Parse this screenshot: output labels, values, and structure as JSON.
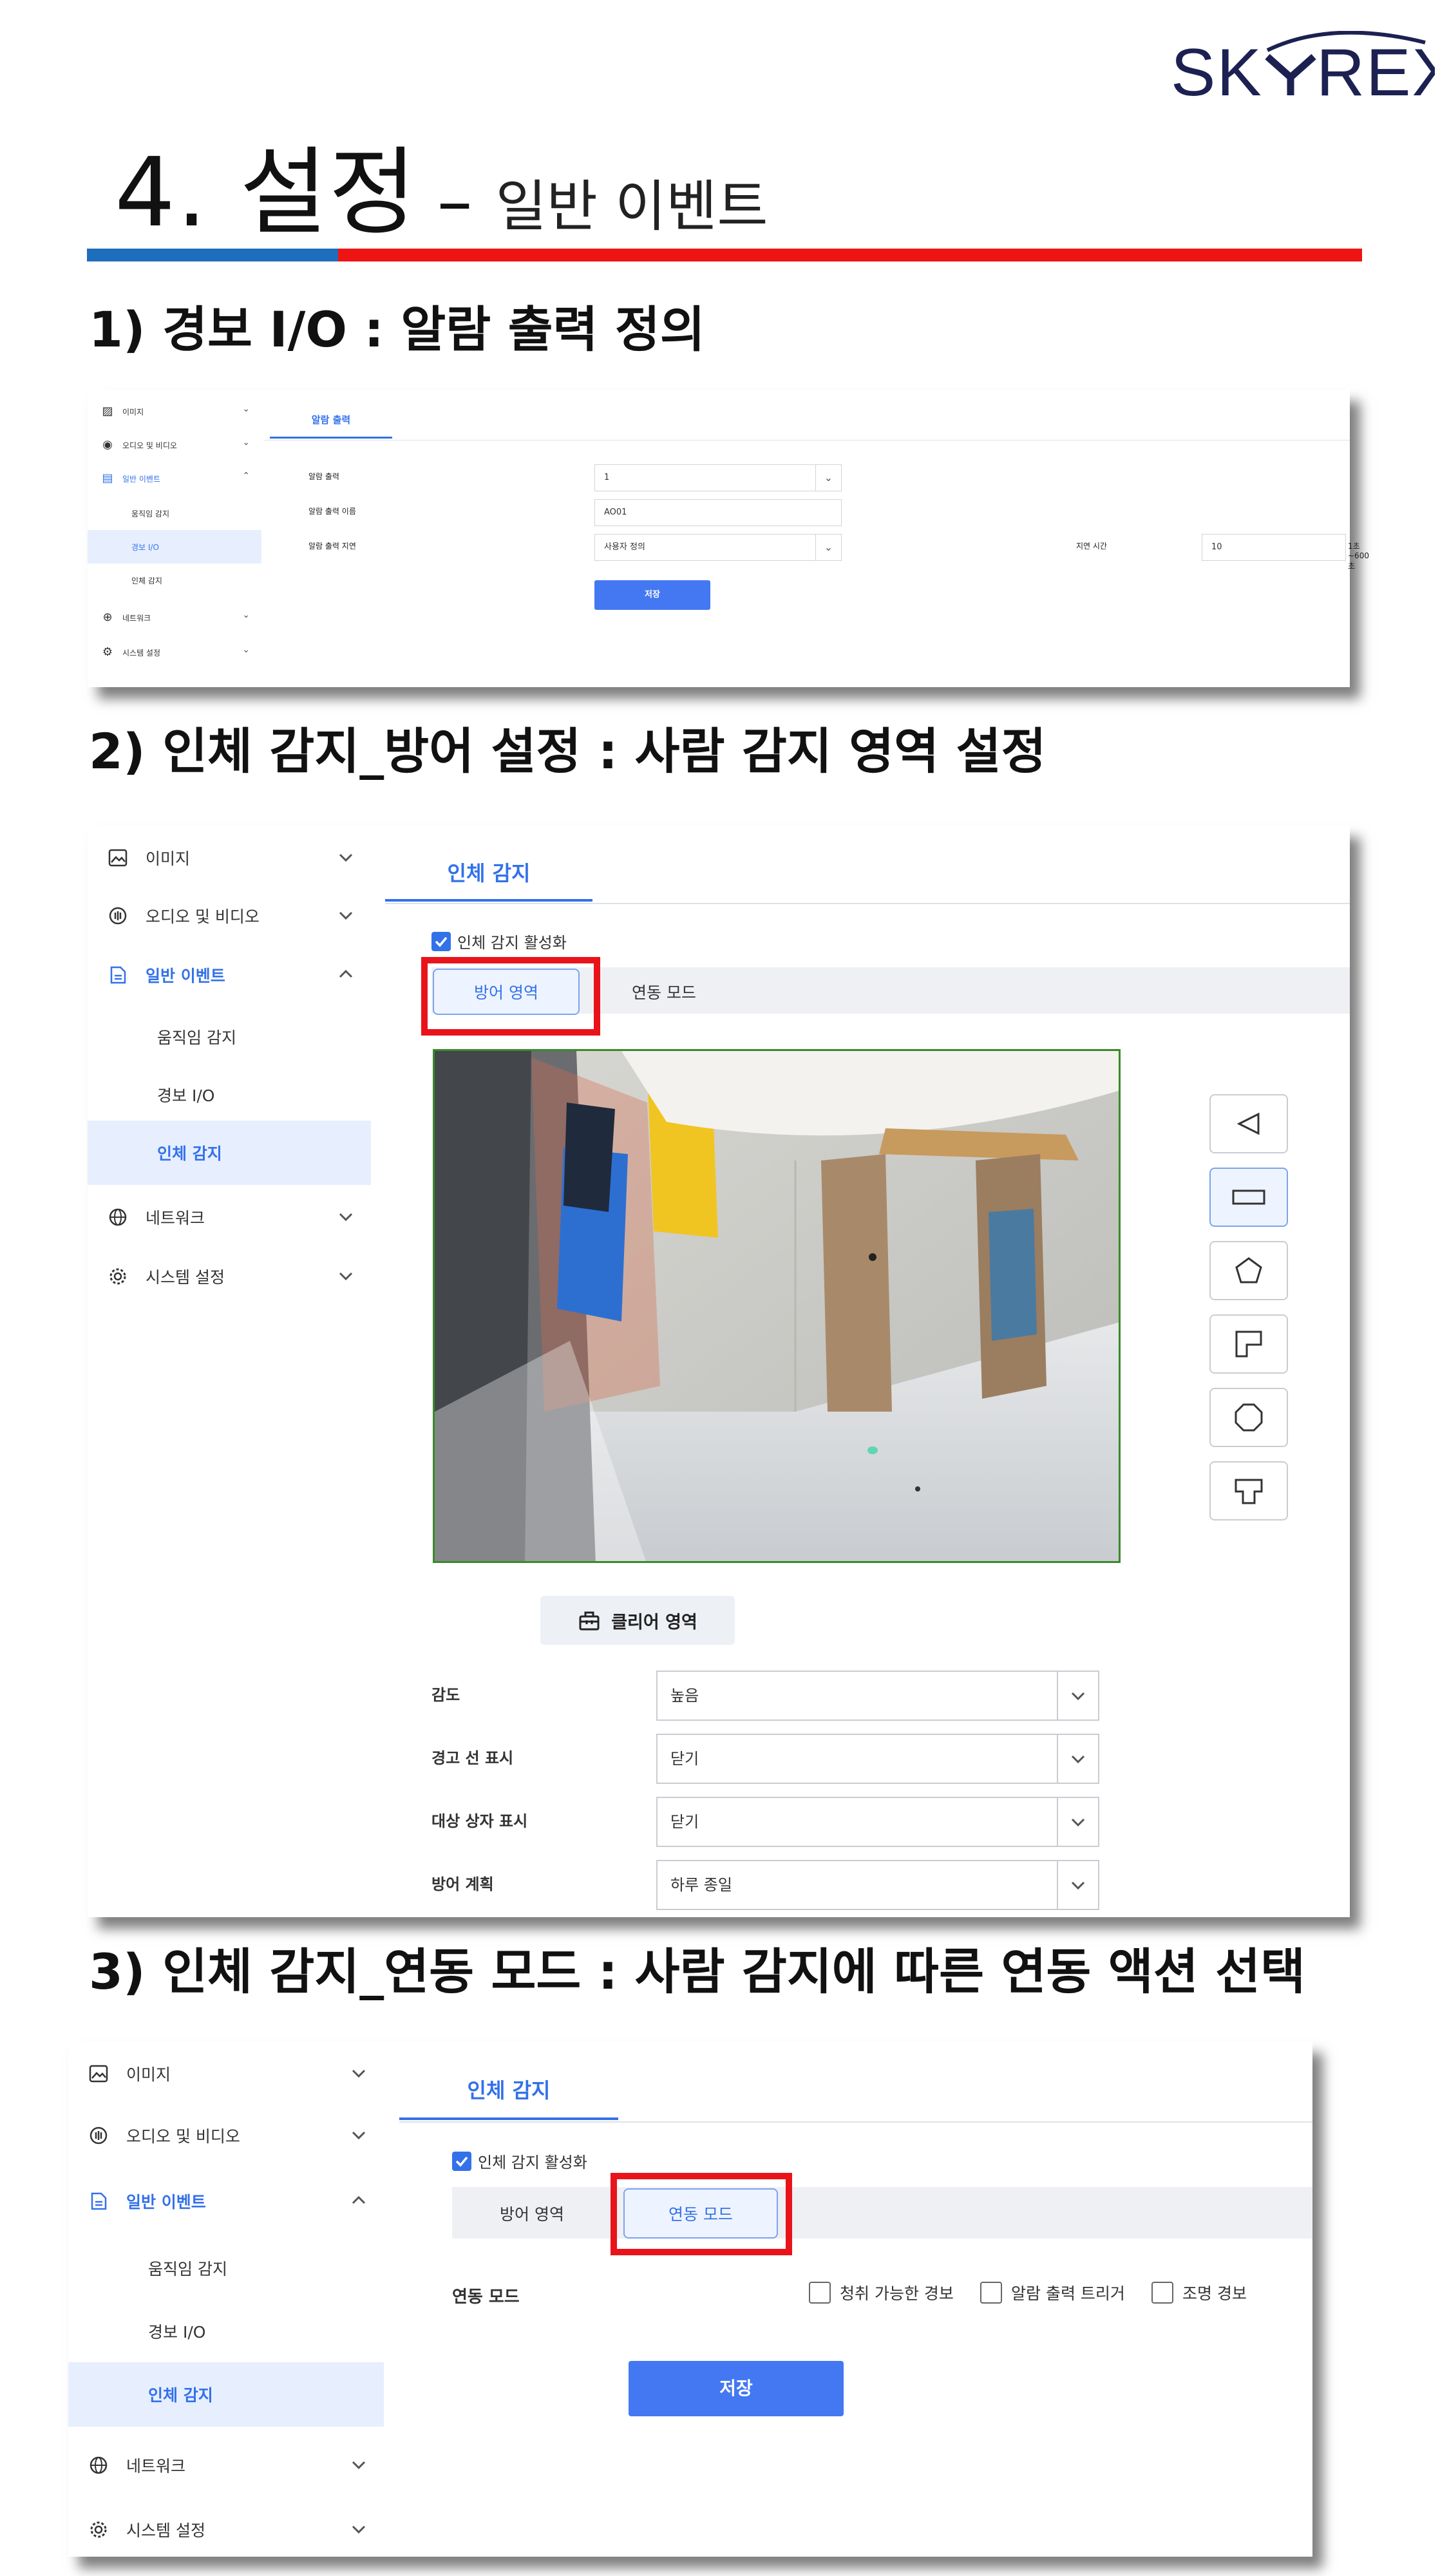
{
  "brand": {
    "logo_text": "SKYREX",
    "logo_color": "#1c2152"
  },
  "page": {
    "title_main": "4. 설정",
    "title_dash": "–",
    "title_sub": "일반 이벤트"
  },
  "colors": {
    "accent_blue": "#3371ea",
    "button_blue": "#4478f2",
    "highlight_red": "#e8141a",
    "bar_blue": "#1f6dbd",
    "bar_red": "#ee1414"
  },
  "sections": [
    {
      "heading": "1) 경보 I/O : 알람 출력 정의"
    },
    {
      "heading": "2) 인체 감지_방어 설정 : 사람 감지 영역 설정"
    },
    {
      "heading": "3) 인체 감지_연동 모드 : 사람 감지에 따른 연동 액션 선택"
    }
  ],
  "sidebar": {
    "image": "이미지",
    "audio_video": "오디오 및 비디오",
    "general_event": "일반 이벤트",
    "motion": "움직임 감지",
    "alarm_io": "경보 I/O",
    "human": "인체 감지",
    "network": "네트워크",
    "system": "시스템 설정"
  },
  "alarm_output": {
    "tab": "알람 출력",
    "label_output": "알람 출력",
    "value_output": "1",
    "label_name": "알람 출력 이름",
    "value_name": "AO01",
    "label_delay": "알람 출력 지연",
    "value_delay": "사용자 정의",
    "label_delay_time": "지연 시간",
    "value_delay_time": "10",
    "delay_range": "1초~600초",
    "save": "저장"
  },
  "human_detect": {
    "tab": "인체 감지",
    "enable": "인체 감지 활성화",
    "subtab_area": "방어 영역",
    "subtab_link": "연동 모드",
    "clear_area": "클리어 영역",
    "tools": [
      "triangle-icon",
      "rectangle-icon",
      "pentagon-icon",
      "l-shape-icon",
      "hexagon-icon",
      "t-shape-icon"
    ],
    "fields": [
      {
        "label": "감도",
        "value": "높음"
      },
      {
        "label": "경고 선 표시",
        "value": "닫기"
      },
      {
        "label": "대상 상자 표시",
        "value": "닫기"
      },
      {
        "label": "방어 계획",
        "value": "하루 종일"
      }
    ]
  },
  "link_mode": {
    "tab": "인체 감지",
    "enable": "인체 감지 활성화",
    "subtab_area": "방어 영역",
    "subtab_link": "연동 모드",
    "label": "연동 모드",
    "options": [
      "청취 가능한 경보",
      "알람 출력 트리거",
      "조명 경보"
    ],
    "save": "저장"
  }
}
